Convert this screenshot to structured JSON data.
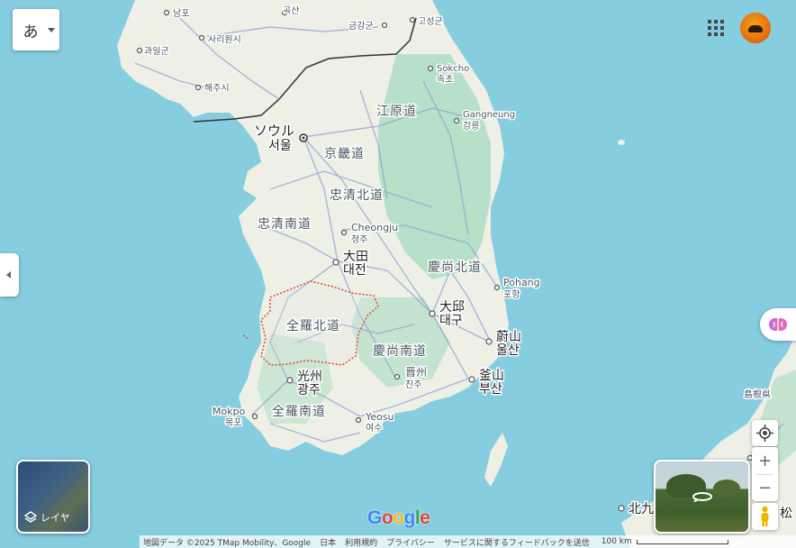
{
  "ime": {
    "glyph": "あ"
  },
  "layers": {
    "label": "レイヤ"
  },
  "google_logo": {
    "G": "G",
    "o1": "o",
    "o2": "o",
    "g": "g",
    "l": "l",
    "e": "e"
  },
  "footer": {
    "map_data": "地図データ ©2025 TMap Mobility、Google",
    "country": "日本",
    "terms": "利用規約",
    "privacy": "プライバシー",
    "feedback": "サービスに関するフィードバックを送信",
    "scale": "100 km"
  },
  "labels": {
    "nampo": "남포",
    "goksan": "곡산",
    "geumgang": "금강군",
    "goseong": "고성군",
    "sariwon": "사리원시",
    "gwail": "과일군",
    "haeju": "해주시",
    "sokcho_en": "Sokcho",
    "sokcho_ko": "속초",
    "gangwon": "江原道",
    "gangneung_en": "Gangneung",
    "gangneung_ko": "강릉",
    "seoul_ja": "ソウル",
    "seoul_ko": "서울",
    "gyeonggi": "京畿道",
    "chungbuk": "忠清北道",
    "chungnam": "忠清南道",
    "cheongju_en": "Cheongju",
    "cheongju_ko": "청주",
    "daejeon_ja": "大田",
    "daejeon_ko": "대전",
    "gyeongbuk": "慶尚北道",
    "pohang_en": "Pohang",
    "pohang_ko": "포항",
    "jeonbuk": "全羅北道",
    "daegu_ja": "大邱",
    "daegu_ko": "대구",
    "ulsan_ja": "蔚山",
    "ulsan_ko": "울산",
    "gyeongnam": "慶尚南道",
    "jinju_ja": "晋州",
    "jinju_ko": "진주",
    "gwangju_ja": "光州",
    "gwangju_ko": "광주",
    "busan_ja": "釜山",
    "busan_ko": "부산",
    "mokpo_en": "Mokpo",
    "mokpo_ko": "목포",
    "jeonnam": "全羅南道",
    "yeosu_en": "Yeosu",
    "yeosu_ko": "여수",
    "shimane": "島根県",
    "kitakyushu": "北九",
    "matsu": "松"
  },
  "colors": {
    "sea": "#86cde0",
    "land": "#eef0e6",
    "green": "#a8dcbf",
    "road": "#8fa3d1",
    "highlight": "#e04b3a"
  }
}
